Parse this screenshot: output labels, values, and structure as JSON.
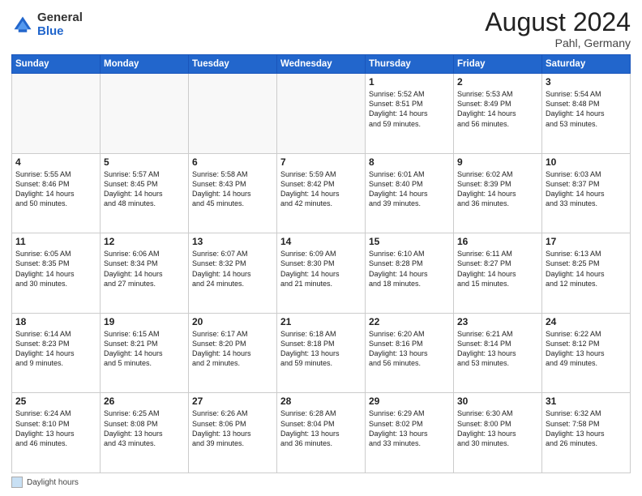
{
  "header": {
    "logo_general": "General",
    "logo_blue": "Blue",
    "month_title": "August 2024",
    "location": "Pahl, Germany"
  },
  "footer": {
    "daylight_label": "Daylight hours"
  },
  "weekdays": [
    "Sunday",
    "Monday",
    "Tuesday",
    "Wednesday",
    "Thursday",
    "Friday",
    "Saturday"
  ],
  "weeks": [
    [
      {
        "day": "",
        "info": ""
      },
      {
        "day": "",
        "info": ""
      },
      {
        "day": "",
        "info": ""
      },
      {
        "day": "",
        "info": ""
      },
      {
        "day": "1",
        "info": "Sunrise: 5:52 AM\nSunset: 8:51 PM\nDaylight: 14 hours\nand 59 minutes."
      },
      {
        "day": "2",
        "info": "Sunrise: 5:53 AM\nSunset: 8:49 PM\nDaylight: 14 hours\nand 56 minutes."
      },
      {
        "day": "3",
        "info": "Sunrise: 5:54 AM\nSunset: 8:48 PM\nDaylight: 14 hours\nand 53 minutes."
      }
    ],
    [
      {
        "day": "4",
        "info": "Sunrise: 5:55 AM\nSunset: 8:46 PM\nDaylight: 14 hours\nand 50 minutes."
      },
      {
        "day": "5",
        "info": "Sunrise: 5:57 AM\nSunset: 8:45 PM\nDaylight: 14 hours\nand 48 minutes."
      },
      {
        "day": "6",
        "info": "Sunrise: 5:58 AM\nSunset: 8:43 PM\nDaylight: 14 hours\nand 45 minutes."
      },
      {
        "day": "7",
        "info": "Sunrise: 5:59 AM\nSunset: 8:42 PM\nDaylight: 14 hours\nand 42 minutes."
      },
      {
        "day": "8",
        "info": "Sunrise: 6:01 AM\nSunset: 8:40 PM\nDaylight: 14 hours\nand 39 minutes."
      },
      {
        "day": "9",
        "info": "Sunrise: 6:02 AM\nSunset: 8:39 PM\nDaylight: 14 hours\nand 36 minutes."
      },
      {
        "day": "10",
        "info": "Sunrise: 6:03 AM\nSunset: 8:37 PM\nDaylight: 14 hours\nand 33 minutes."
      }
    ],
    [
      {
        "day": "11",
        "info": "Sunrise: 6:05 AM\nSunset: 8:35 PM\nDaylight: 14 hours\nand 30 minutes."
      },
      {
        "day": "12",
        "info": "Sunrise: 6:06 AM\nSunset: 8:34 PM\nDaylight: 14 hours\nand 27 minutes."
      },
      {
        "day": "13",
        "info": "Sunrise: 6:07 AM\nSunset: 8:32 PM\nDaylight: 14 hours\nand 24 minutes."
      },
      {
        "day": "14",
        "info": "Sunrise: 6:09 AM\nSunset: 8:30 PM\nDaylight: 14 hours\nand 21 minutes."
      },
      {
        "day": "15",
        "info": "Sunrise: 6:10 AM\nSunset: 8:28 PM\nDaylight: 14 hours\nand 18 minutes."
      },
      {
        "day": "16",
        "info": "Sunrise: 6:11 AM\nSunset: 8:27 PM\nDaylight: 14 hours\nand 15 minutes."
      },
      {
        "day": "17",
        "info": "Sunrise: 6:13 AM\nSunset: 8:25 PM\nDaylight: 14 hours\nand 12 minutes."
      }
    ],
    [
      {
        "day": "18",
        "info": "Sunrise: 6:14 AM\nSunset: 8:23 PM\nDaylight: 14 hours\nand 9 minutes."
      },
      {
        "day": "19",
        "info": "Sunrise: 6:15 AM\nSunset: 8:21 PM\nDaylight: 14 hours\nand 5 minutes."
      },
      {
        "day": "20",
        "info": "Sunrise: 6:17 AM\nSunset: 8:20 PM\nDaylight: 14 hours\nand 2 minutes."
      },
      {
        "day": "21",
        "info": "Sunrise: 6:18 AM\nSunset: 8:18 PM\nDaylight: 13 hours\nand 59 minutes."
      },
      {
        "day": "22",
        "info": "Sunrise: 6:20 AM\nSunset: 8:16 PM\nDaylight: 13 hours\nand 56 minutes."
      },
      {
        "day": "23",
        "info": "Sunrise: 6:21 AM\nSunset: 8:14 PM\nDaylight: 13 hours\nand 53 minutes."
      },
      {
        "day": "24",
        "info": "Sunrise: 6:22 AM\nSunset: 8:12 PM\nDaylight: 13 hours\nand 49 minutes."
      }
    ],
    [
      {
        "day": "25",
        "info": "Sunrise: 6:24 AM\nSunset: 8:10 PM\nDaylight: 13 hours\nand 46 minutes."
      },
      {
        "day": "26",
        "info": "Sunrise: 6:25 AM\nSunset: 8:08 PM\nDaylight: 13 hours\nand 43 minutes."
      },
      {
        "day": "27",
        "info": "Sunrise: 6:26 AM\nSunset: 8:06 PM\nDaylight: 13 hours\nand 39 minutes."
      },
      {
        "day": "28",
        "info": "Sunrise: 6:28 AM\nSunset: 8:04 PM\nDaylight: 13 hours\nand 36 minutes."
      },
      {
        "day": "29",
        "info": "Sunrise: 6:29 AM\nSunset: 8:02 PM\nDaylight: 13 hours\nand 33 minutes."
      },
      {
        "day": "30",
        "info": "Sunrise: 6:30 AM\nSunset: 8:00 PM\nDaylight: 13 hours\nand 30 minutes."
      },
      {
        "day": "31",
        "info": "Sunrise: 6:32 AM\nSunset: 7:58 PM\nDaylight: 13 hours\nand 26 minutes."
      }
    ]
  ]
}
